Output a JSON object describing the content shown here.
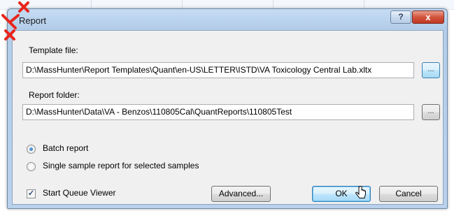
{
  "dialog": {
    "title": "Report",
    "help_label": "?",
    "close_label": "x"
  },
  "template": {
    "label": "Template file:",
    "value": "D:\\MassHunter\\Report Templates\\Quant\\en-US\\LETTER\\ISTD\\VA Toxicology Central Lab.xltx",
    "browse_label": "..."
  },
  "report_folder": {
    "label": "Report folder:",
    "value": "D:\\MassHunter\\Data\\VA - Benzos\\110805Cal\\QuantReports\\110805Test",
    "browse_label": "..."
  },
  "report_type": {
    "options": [
      {
        "label": "Batch report",
        "checked": true
      },
      {
        "label": "Single sample report for selected samples",
        "checked": false
      }
    ]
  },
  "queue_viewer": {
    "label": "Start Queue Viewer",
    "checked": true,
    "check_glyph": "✓"
  },
  "buttons": {
    "advanced": "Advanced...",
    "ok": "OK",
    "cancel": "Cancel"
  },
  "colors": {
    "annotation_red": "#e8261c",
    "frame_blue": "#b9d1ec",
    "close_red": "#c03822"
  }
}
